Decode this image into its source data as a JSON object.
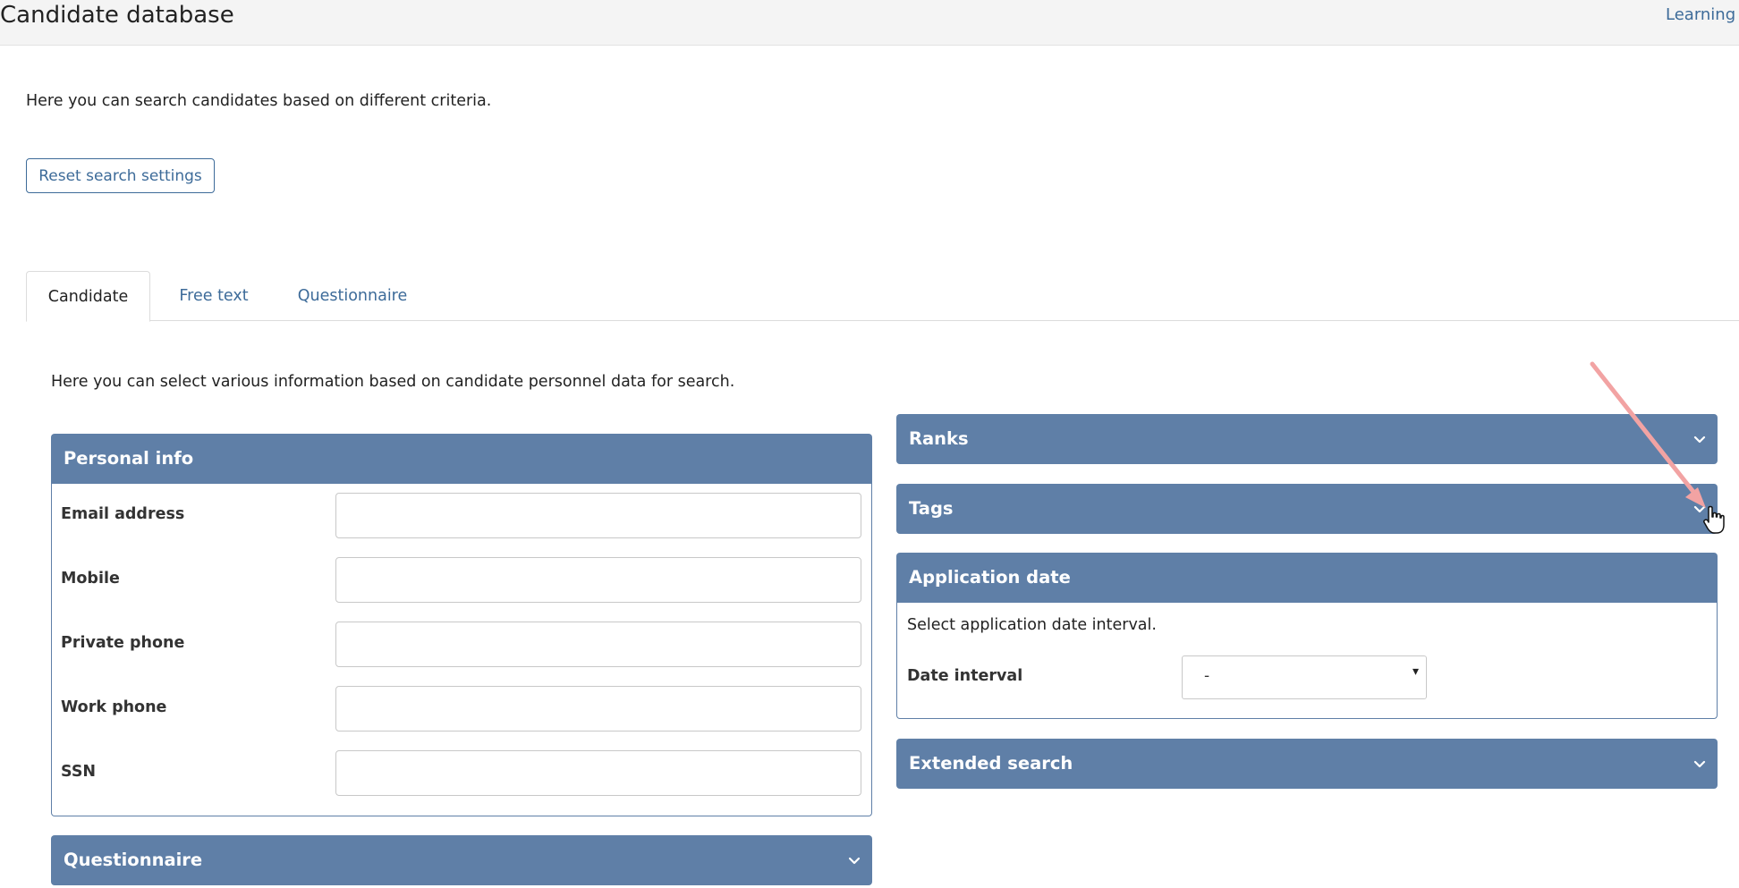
{
  "header": {
    "title": "Candidate database",
    "top_link": "Learning"
  },
  "intro": "Here you can search candidates based on different criteria.",
  "reset_button": "Reset search settings",
  "tabs": [
    {
      "label": "Candidate",
      "active": true
    },
    {
      "label": "Free text",
      "active": false
    },
    {
      "label": "Questionnaire",
      "active": false
    }
  ],
  "candidate_tab": {
    "description": "Here you can select various information based on candidate personnel data for search.",
    "personal_info": {
      "title": "Personal info",
      "fields": [
        {
          "label": "Email address",
          "value": ""
        },
        {
          "label": "Mobile",
          "value": ""
        },
        {
          "label": "Private phone",
          "value": ""
        },
        {
          "label": "Work phone",
          "value": ""
        },
        {
          "label": "SSN",
          "value": ""
        }
      ]
    },
    "questionnaire_panel": {
      "title": "Questionnaire",
      "expanded": false
    },
    "ranks_panel": {
      "title": "Ranks",
      "expanded": false
    },
    "tags_panel": {
      "title": "Tags",
      "expanded": false
    },
    "application_date": {
      "title": "Application date",
      "hint": "Select application date interval.",
      "date_interval_label": "Date interval",
      "date_interval_value": "-"
    },
    "extended_search_panel": {
      "title": "Extended search",
      "expanded": false
    }
  },
  "colors": {
    "panel_header": "#5f7fa7",
    "link": "#3d6b99",
    "annotation_arrow": "#f2a3a3"
  },
  "icons": {
    "collapse_chevron": "chevron-down-icon",
    "cursor": "hand-pointer-icon",
    "annotation": "arrow-annotation-icon"
  }
}
